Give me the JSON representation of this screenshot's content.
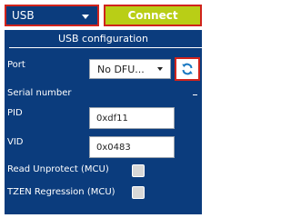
{
  "toolbar": {
    "interface_value": "USB",
    "connect_label": "Connect"
  },
  "panel": {
    "title": "USB configuration",
    "port_label": "Port",
    "port_value": "No DFU...",
    "serial_label": "Serial number",
    "pid_label": "PID",
    "pid_value": "0xdf11",
    "vid_label": "VID",
    "vid_value": "0x0483",
    "read_unprotect_label": "Read Unprotect (MCU)",
    "tzen_label": "TZEN Regression (MCU)"
  },
  "icons": {
    "refresh": "refresh-icon",
    "dropdown": "chevron-down-icon"
  },
  "colors": {
    "panel_bg": "#0b3c7d",
    "connect_bg": "#b9ce16",
    "highlight_border": "#d0231c",
    "refresh_icon": "#1a78c2"
  }
}
